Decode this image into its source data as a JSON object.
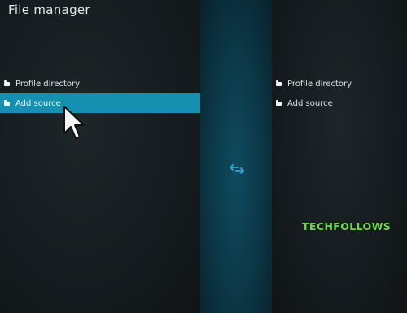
{
  "window": {
    "title": "File manager"
  },
  "left_panel": {
    "items": [
      {
        "label": "Profile directory",
        "icon": "folder-icon",
        "selected": false
      },
      {
        "label": "Add source",
        "icon": "folder-icon",
        "selected": true
      }
    ]
  },
  "right_panel": {
    "items": [
      {
        "label": "Profile directory",
        "icon": "folder-icon"
      },
      {
        "label": "Add source",
        "icon": "folder-icon"
      }
    ]
  },
  "center": {
    "icon": "swap-arrows-icon"
  },
  "watermark": {
    "text": "TECHFOLLOWS"
  },
  "colors": {
    "selection": "#1590b0",
    "center_strip": "#0c3a4a",
    "swap_icon": "#2aa8d8",
    "watermark": "#6fd84a"
  }
}
